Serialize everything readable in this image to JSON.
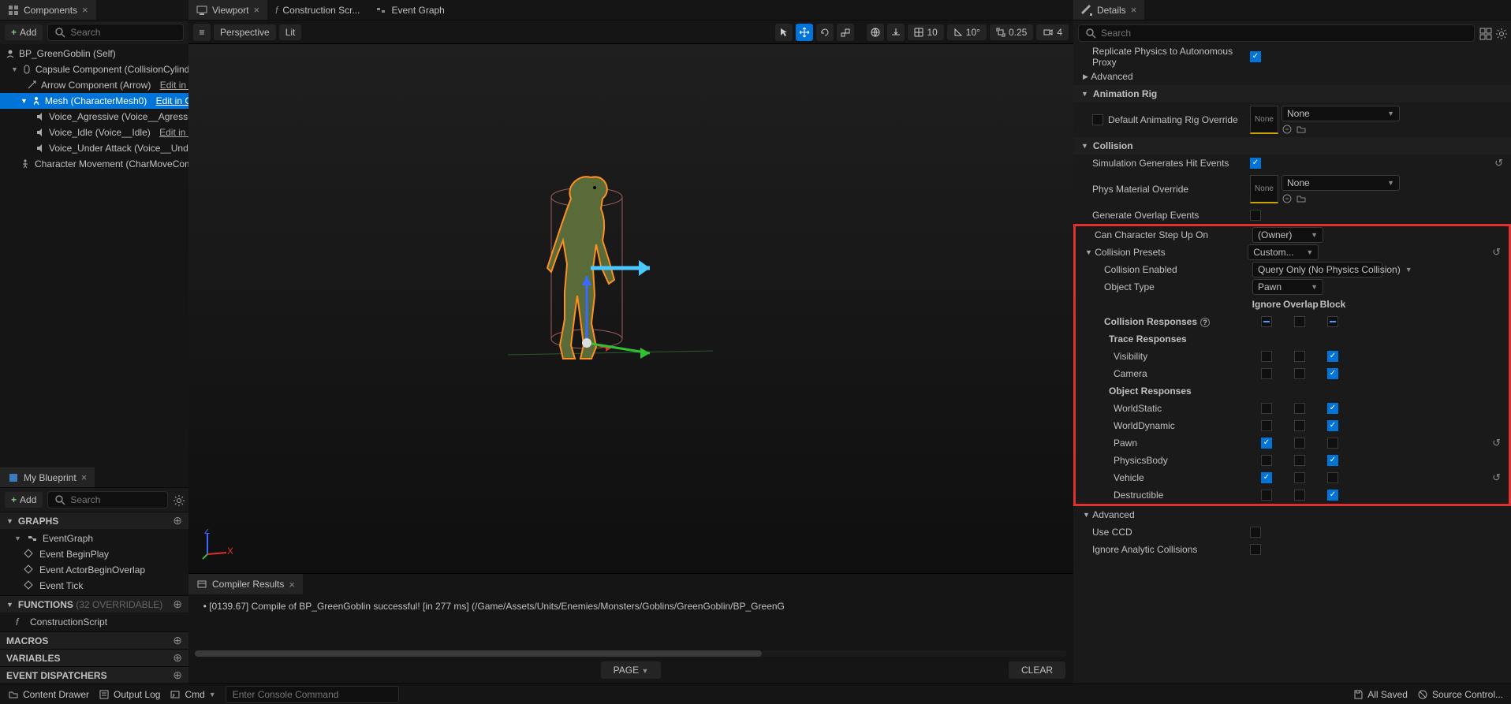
{
  "tabs": {
    "components": "Components",
    "viewport": "Viewport",
    "construction": "Construction Scr...",
    "eventgraph": "Event Graph",
    "details": "Details",
    "myblueprint": "My Blueprint",
    "compiler": "Compiler Results"
  },
  "buttons": {
    "add": "Add"
  },
  "search": {
    "placeholder": "Search"
  },
  "tree": {
    "root": "BP_GreenGoblin (Self)",
    "capsule": "Capsule Component (CollisionCylinder)",
    "arrow": "Arrow Component (Arrow)",
    "mesh": "Mesh (CharacterMesh0)",
    "voice_agr": "Voice_Agressive (Voice__Agressive",
    "voice_idle": "Voice_Idle (Voice__Idle)",
    "voice_under": "Voice_Under Attack (Voice__UnderA",
    "charmove": "Character Movement (CharMoveComp)",
    "edit_cpp": "Edit in C++"
  },
  "viewport": {
    "perspective": "Perspective",
    "lit": "Lit",
    "snap_grid": "10",
    "snap_angle": "10°",
    "snap_scale": "0.25",
    "cam_speed": "4"
  },
  "myblueprint": {
    "graphs": "GRAPHS",
    "eventgraph": "EventGraph",
    "beginplay": "Event BeginPlay",
    "actorbegin": "Event ActorBeginOverlap",
    "tick": "Event Tick",
    "functions": "FUNCTIONS",
    "overridable": "(32 OVERRIDABLE)",
    "construction": "ConstructionScript",
    "macros": "MACROS",
    "variables": "VARIABLES",
    "dispatchers": "EVENT DISPATCHERS"
  },
  "compiler": {
    "msg": "  • [0139.67] Compile of BP_GreenGoblin successful! [in 277 ms] (/Game/Assets/Units/Enemies/Monsters/Goblins/GreenGoblin/BP_GreenG",
    "page": "PAGE",
    "clear": "CLEAR"
  },
  "details": {
    "replicate_phys": "Replicate Physics to Autonomous Proxy",
    "advanced": "Advanced",
    "anim_rig": "Animation Rig",
    "default_anim_override": "Default Animating Rig Override",
    "none": "None",
    "collision": "Collision",
    "sim_hit": "Simulation Generates Hit Events",
    "phys_mat": "Phys Material Override",
    "gen_overlap": "Generate Overlap Events",
    "can_step": "Can Character Step Up On",
    "owner": "(Owner)",
    "coll_presets": "Collision Presets",
    "custom": "Custom...",
    "coll_enabled": "Collision Enabled",
    "query_only": "Query Only (No Physics Collision)",
    "obj_type": "Object Type",
    "pawn": "Pawn",
    "ignore": "Ignore",
    "overlap": "Overlap",
    "block": "Block",
    "coll_resp": "Collision Responses",
    "trace_resp": "Trace Responses",
    "visibility": "Visibility",
    "camera": "Camera",
    "obj_resp": "Object Responses",
    "worldstatic": "WorldStatic",
    "worlddynamic": "WorldDynamic",
    "pawn_resp": "Pawn",
    "physicsbody": "PhysicsBody",
    "vehicle": "Vehicle",
    "destructible": "Destructible",
    "use_ccd": "Use CCD",
    "ignore_analytic": "Ignore Analytic Collisions"
  },
  "bottombar": {
    "content_drawer": "Content Drawer",
    "output_log": "Output Log",
    "cmd": "Cmd",
    "cmd_placeholder": "Enter Console Command",
    "all_saved": "All Saved",
    "source_control": "Source Control..."
  }
}
